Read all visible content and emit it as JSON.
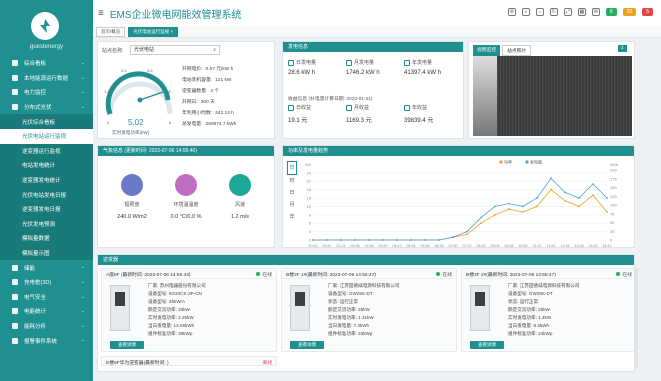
{
  "app": {
    "title": "EMS企业微电网能效管理系统",
    "user": "guestenergy"
  },
  "sidebar": {
    "items": [
      {
        "label": "综合看板",
        "type": "top"
      },
      {
        "label": "本地能源运行数据",
        "type": "top"
      },
      {
        "label": "电力监控",
        "type": "top"
      },
      {
        "label": "分布式光伏",
        "type": "top"
      },
      {
        "label": "光伏综合看板",
        "type": "sub"
      },
      {
        "label": "光伏电站运行监视",
        "type": "sub-active"
      },
      {
        "label": "逆变器运行监视",
        "type": "sub"
      },
      {
        "label": "电站发电统计",
        "type": "sub"
      },
      {
        "label": "逆变器发电统计",
        "type": "sub"
      },
      {
        "label": "光伏电站发电日报",
        "type": "sub"
      },
      {
        "label": "逆变器发电日报",
        "type": "sub"
      },
      {
        "label": "光伏发电预测",
        "type": "sub"
      },
      {
        "label": "模拟量数据",
        "type": "sub"
      },
      {
        "label": "模拟量示图",
        "type": "sub"
      },
      {
        "label": "储能",
        "type": "top"
      },
      {
        "label": "充电桩(3D)",
        "type": "top"
      },
      {
        "label": "电气安全",
        "type": "top"
      },
      {
        "label": "电能统计",
        "type": "top"
      },
      {
        "label": "能耗分析",
        "type": "top"
      },
      {
        "label": "报警事件系统",
        "type": "top"
      }
    ]
  },
  "header": {
    "icons": [
      "settings-icon",
      "search-icon",
      "bell-icon",
      "refresh-icon",
      "fullscreen-icon",
      "grid-icon",
      "message-icon"
    ],
    "badges": [
      {
        "label": "8",
        "color": "#26b05a"
      },
      {
        "label": "20",
        "color": "#f0a020"
      },
      {
        "label": "5",
        "color": "#e04848"
      }
    ]
  },
  "tabs": [
    {
      "label": "首页/概览"
    },
    {
      "label": "光伏电站运行监视 ×",
      "active": true
    }
  ],
  "station": {
    "label": "站点名称:",
    "value": "光伏电站",
    "gauge_value": "5.02",
    "gauge_label": "实时发电功率(kW)",
    "gauge_max": "6",
    "gauge_ticks": [
      "0",
      "1.2",
      "2.4",
      "3.6",
      "4.8",
      "6"
    ],
    "rows": [
      {
        "k": "开网电价:",
        "v": "0.67 元/kW h"
      },
      {
        "k": "电站装机容量:",
        "v": "121 kW"
      },
      {
        "k": "逆变器数量:",
        "v": "4 个"
      },
      {
        "k": "开网日:",
        "v": "300 天"
      },
      {
        "k": "年利用小时数:",
        "v": "342.13 h"
      },
      {
        "k": "总发电量:",
        "v": "260974.7 kWh"
      }
    ]
  },
  "generation": {
    "title": "发电信息",
    "items": [
      {
        "k": "日发电量",
        "v": "28.6 kW h"
      },
      {
        "k": "月发电量",
        "v": "1746.2 kW h"
      },
      {
        "k": "年发电量",
        "v": "41397.4 kW h"
      }
    ],
    "income_label": "收益信息 (补电量计算日期: 2023-01-01)",
    "income": [
      {
        "k": "日收益",
        "v": "19.1 元"
      },
      {
        "k": "月收益",
        "v": "1169.3 元"
      },
      {
        "k": "年收益",
        "v": "39839.4 元"
      }
    ]
  },
  "camera": {
    "tabs": [
      "视频监控",
      "站点照片"
    ],
    "badge": "1"
  },
  "weather": {
    "title": "气象信息 (更新时间: 2023-07-06 14:55:40)",
    "items": [
      {
        "k": "辐照度",
        "v": "240.0 W/m2",
        "color": "#6a78c8",
        "icon": "solar-panel-icon"
      },
      {
        "k": "环境温温度",
        "v": "0.0 °C/0.0 %",
        "color": "#c06cc0",
        "icon": "thermometer-icon"
      },
      {
        "k": "风速",
        "v": "1.2 m/s",
        "color": "#1ba896",
        "icon": "wind-icon"
      }
    ]
  },
  "chart_title": "功率及发电量趋势",
  "chart_data": {
    "type": "line",
    "x": [
      "00:00",
      "00:42",
      "01:24",
      "02:06",
      "02:48",
      "03:30",
      "04:12",
      "04:54",
      "05:36",
      "06:18",
      "07:00",
      "07:42",
      "08:24",
      "09:06",
      "09:48",
      "10:30",
      "11:12",
      "11:54",
      "12:36",
      "13:18",
      "14:00",
      "14:42"
    ],
    "series": [
      {
        "name": "功率",
        "color": "#f0a020",
        "values": [
          0,
          0,
          0,
          0,
          0,
          0,
          0,
          0,
          0,
          0,
          1,
          2,
          6,
          9,
          11,
          10,
          12,
          18,
          14,
          12,
          16,
          10
        ]
      },
      {
        "name": "发电量",
        "color": "#4aa3e0",
        "values": [
          0,
          0,
          0,
          0,
          0,
          0,
          0,
          0,
          0,
          0,
          1,
          3,
          8,
          12,
          13,
          12,
          15,
          22,
          17,
          15,
          20,
          15
        ]
      }
    ],
    "ylim": [
      0,
      25
    ],
    "y2lim": [
      0,
      200
    ],
    "ylabel": "kW",
    "y2label": "kWh",
    "yticks": [
      "0",
      "3",
      "6",
      "9",
      "12",
      "15",
      "18",
      "21",
      "24"
    ],
    "y2ticks": [
      "0",
      "25",
      "50",
      "75",
      "100",
      "125",
      "150",
      "175",
      "200"
    ],
    "legend": "top-right",
    "grid": true
  },
  "chart_side": [
    "日",
    "时",
    "日",
    "月",
    "年"
  ],
  "devices": {
    "title": "逆变器",
    "items": [
      {
        "name": "A座8F (最新时间: 2023-07-06 14:55:43)",
        "status": "在线",
        "vendor": "厂家: 苏州电器股份有限公司",
        "model": "设备型号: 9G33CK-2P-CN",
        "type": "设备型号: 25kW/A",
        "rated": "额定交流功率: 33kW",
        "p": "实时发电功率: 2.25kW",
        "d": "当日发电量: 13.06kWh",
        "cap": "组件标准功率: 35kWp",
        "btn": "查看详情"
      },
      {
        "name": "B楼3F 1#(最新时间: 2023-07-06 14:55:47)",
        "status": "在线",
        "vendor": "厂家: 江苏固德威电源科技有限公司",
        "model": "设备型号: GW25K-DT",
        "type": "状态: 运行正常",
        "rated": "额定交流功率: 25kW",
        "p": "实时发电功率: 1.31kW",
        "d": "当日发电量: 7.4kWh",
        "cap": "组件标准功率: 23kWp",
        "btn": "查看详情"
      },
      {
        "name": "B楼3F 2#(最新时间: 2023-07-06 14:55:47)",
        "status": "在线",
        "vendor": "厂家: 江苏固德威电源科技有限公司",
        "model": "设备型号: GW25K-DT",
        "type": "状态: 运行正常",
        "rated": "额定交流功率: 25kW",
        "p": "实时发电功率: 1.4kW",
        "d": "当日发电量: 8.2kWh",
        "cap": "组件标准功率: 24kWp",
        "btn": "查看详情"
      }
    ],
    "extra": {
      "name": "E楼6F华为逆变器(最新时间: )",
      "status": "离线"
    }
  }
}
